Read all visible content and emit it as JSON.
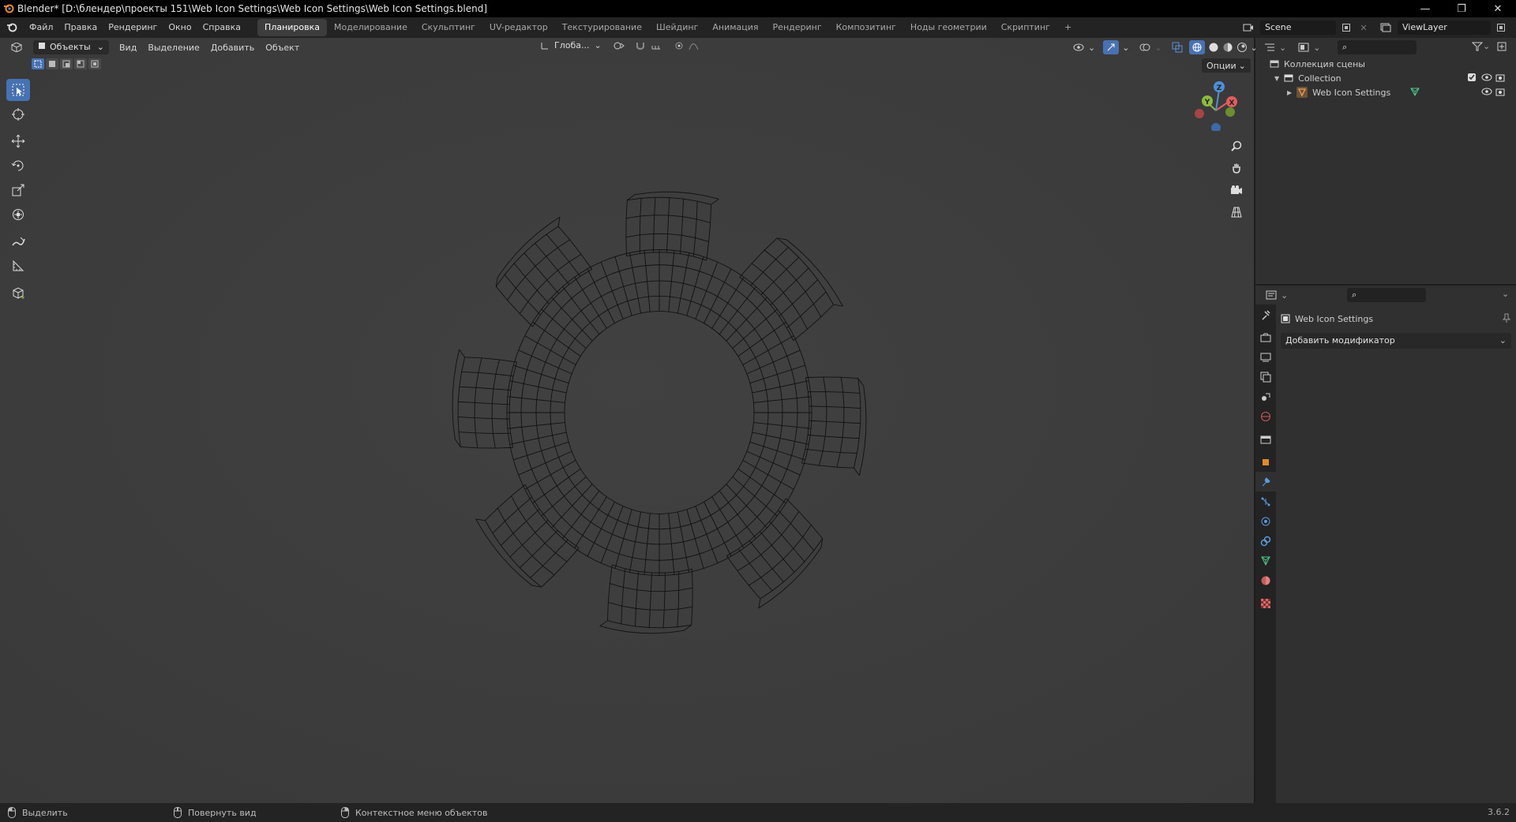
{
  "window": {
    "title": "Blender* [D:\\блендер\\проекты 151\\Web Icon Settings\\Web Icon Settings\\Web Icon Settings.blend]",
    "minimize": "—",
    "restore": "❐",
    "close": "✕"
  },
  "menu": [
    "Файл",
    "Правка",
    "Рендеринг",
    "Окно",
    "Справка"
  ],
  "workspaces": [
    "Планировка",
    "Моделирование",
    "Скульптинг",
    "UV-редактор",
    "Текстурирование",
    "Шейдинг",
    "Анимация",
    "Рендеринг",
    "Композитинг",
    "Ноды геометрии",
    "Скриптинг",
    "+"
  ],
  "active_workspace": "Планировка",
  "scene": {
    "name": "Scene",
    "view_layer": "ViewLayer"
  },
  "viewport": {
    "mode": "Объекты",
    "menus": [
      "Вид",
      "Выделение",
      "Добавить",
      "Объект"
    ],
    "orientation": "Глоба...",
    "options_label": "Опции",
    "gizmo": {
      "x": "X",
      "y": "Y",
      "z": "Z"
    }
  },
  "tools": [
    "select-box",
    "cursor",
    "move",
    "rotate",
    "scale",
    "transform",
    "annotate",
    "measure",
    "add-cube"
  ],
  "outliner": {
    "root": "Коллекция сцены",
    "collection": "Collection",
    "object": "Web Icon Settings"
  },
  "properties": {
    "object_name": "Web Icon Settings",
    "add_modifier": "Добавить модификатор"
  },
  "statusbar": {
    "select": "Выделить",
    "rotate_view": "Повернуть вид",
    "context_menu": "Контекстное меню объектов",
    "version": "3.6.2"
  },
  "colors": {
    "accent": "#4772b3",
    "axis_x": "#e35d5d",
    "axis_y": "#8cbc3a",
    "axis_z": "#4f8fd9",
    "blender_orange": "#f08a24"
  }
}
